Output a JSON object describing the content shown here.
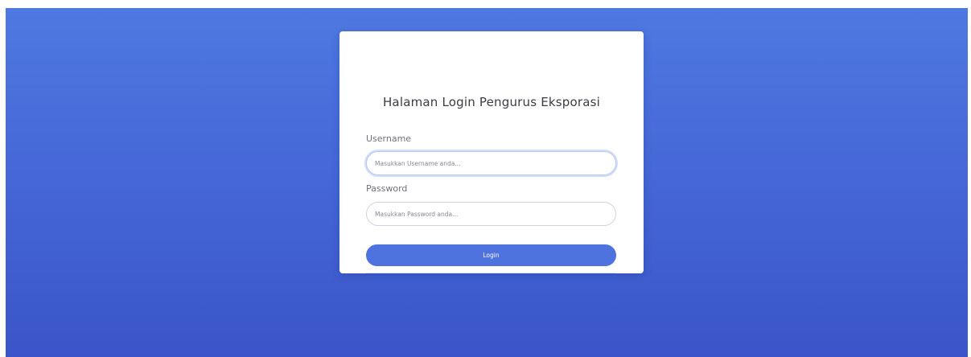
{
  "page": {
    "background_color": "#4e73df"
  },
  "login_card": {
    "title": "Halaman Login Pengurus Eksporasi",
    "username": {
      "label": "Username",
      "placeholder": "Masukkan Username anda..."
    },
    "password": {
      "label": "Password",
      "placeholder": "Masukkan Password anda..."
    },
    "login_button": {
      "label": "Login",
      "color": "#4e73df"
    }
  }
}
